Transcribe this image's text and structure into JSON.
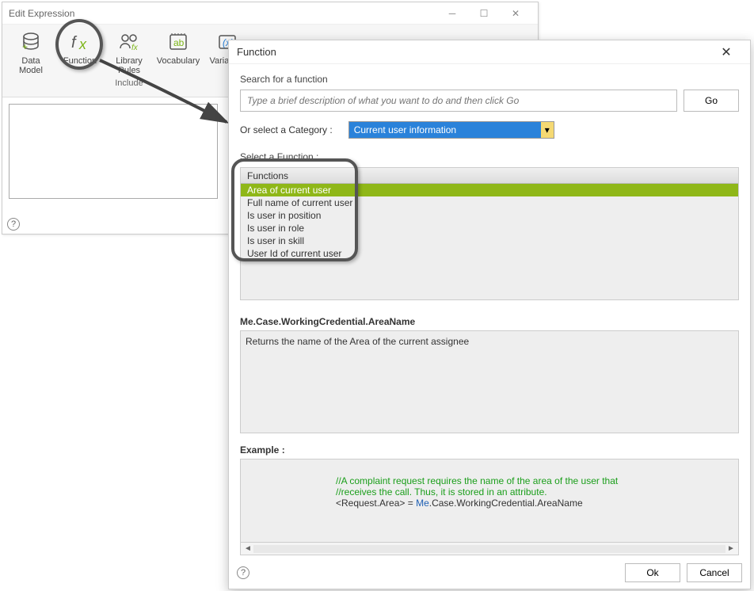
{
  "edit_window": {
    "title": "Edit Expression",
    "ribbon": {
      "group_label": "Include",
      "items": [
        {
          "label": "Data\nModel"
        },
        {
          "label": "Function"
        },
        {
          "label": "Library\nRules"
        },
        {
          "label": "Vocabulary"
        },
        {
          "label": "Variables"
        }
      ]
    }
  },
  "function_window": {
    "title": "Function",
    "search_label": "Search for a function",
    "search_placeholder": "Type a brief description of what you want to do and then click Go",
    "go_label": "Go",
    "category_label": "Or select a Category :",
    "category_value": "Current user information",
    "select_function_label": "Select a Function :",
    "functions_header": "Functions",
    "functions": [
      "Area of current user",
      "Full name of current user",
      "Is user in position",
      "Is user in role",
      "Is user in skill",
      "User Id of current user"
    ],
    "signature": "Me.Case.WorkingCredential.AreaName",
    "description": "Returns the name of the Area of the current assignee",
    "example_label": "Example :",
    "example": {
      "comment1": "//A complaint request requires the name of the area of the user that",
      "comment2": "//receives the call. Thus, it is stored in an attribute.",
      "code_pre": "<Request.Area> = ",
      "code_key": "Me",
      "code_post": ".Case.WorkingCredential.AreaName"
    },
    "ok_label": "Ok",
    "cancel_label": "Cancel"
  }
}
